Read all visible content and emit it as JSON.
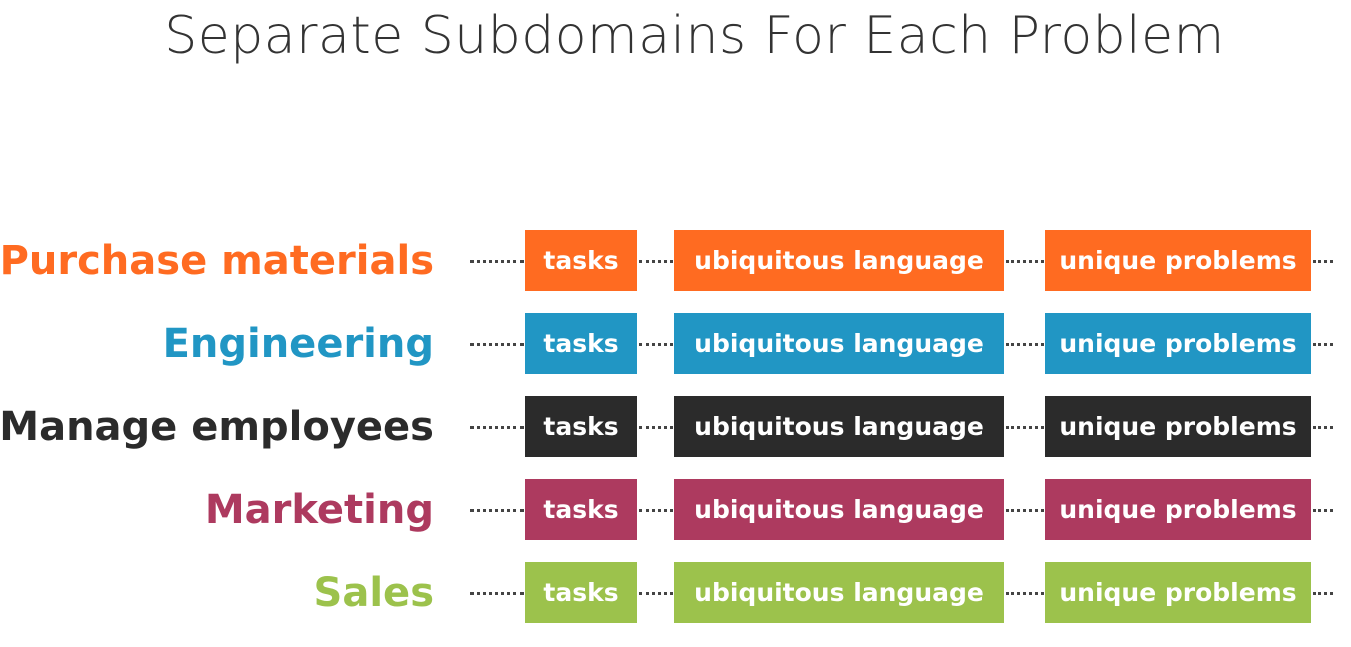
{
  "title": "Separate Subdomains For Each Problem",
  "box_labels": {
    "tasks": "tasks",
    "language": "ubiquitous language",
    "problems": "unique problems"
  },
  "rows": [
    {
      "label": "Purchase materials",
      "color": "#ff6b21"
    },
    {
      "label": "Engineering",
      "color": "#2196c4"
    },
    {
      "label": "Manage employees",
      "color": "#2b2b2b"
    },
    {
      "label": "Marketing",
      "color": "#ad3a5f"
    },
    {
      "label": "Sales",
      "color": "#9cc24c"
    }
  ]
}
